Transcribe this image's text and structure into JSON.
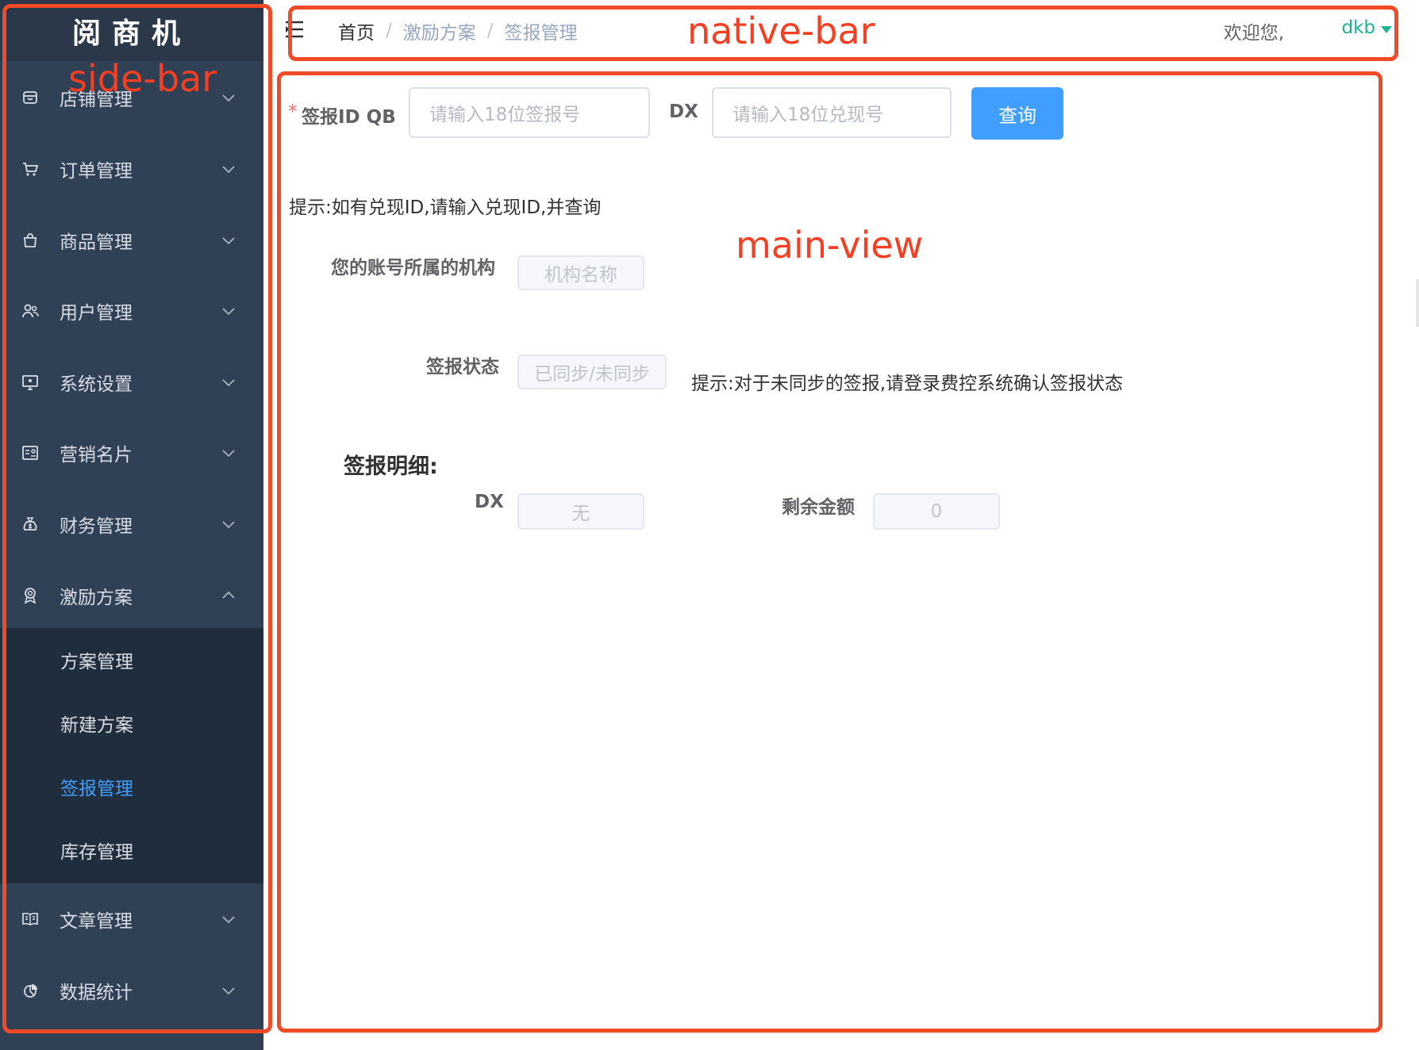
{
  "sidebar": {
    "logo": "阅商机",
    "menu_items": [
      {
        "label": "店铺管理",
        "icon": "shop-icon",
        "expanded": false
      },
      {
        "label": "订单管理",
        "icon": "cart-icon",
        "expanded": false
      },
      {
        "label": "商品管理",
        "icon": "bag-icon",
        "expanded": false
      },
      {
        "label": "用户管理",
        "icon": "users-icon",
        "expanded": false
      },
      {
        "label": "系统设置",
        "icon": "monitor-icon",
        "expanded": false
      },
      {
        "label": "营销名片",
        "icon": "card-icon",
        "expanded": false
      },
      {
        "label": "财务管理",
        "icon": "money-bag-icon",
        "expanded": false
      },
      {
        "label": "激励方案",
        "icon": "award-icon",
        "expanded": true
      },
      {
        "label": "文章管理",
        "icon": "book-icon",
        "expanded": false
      },
      {
        "label": "数据统计",
        "icon": "pie-chart-icon",
        "expanded": false
      }
    ],
    "submenu": [
      {
        "label": "方案管理",
        "active": false
      },
      {
        "label": "新建方案",
        "active": false
      },
      {
        "label": "签报管理",
        "active": true
      },
      {
        "label": "库存管理",
        "active": false
      }
    ]
  },
  "navbar": {
    "breadcrumb": [
      "首页",
      "激励方案",
      "签报管理"
    ],
    "welcome": "欢迎您,",
    "username": "dkb"
  },
  "annotations": {
    "side_bar": "side-bar",
    "native_bar": "native-bar",
    "main_view": "main-view"
  },
  "form": {
    "required_mark": "*",
    "qb_label": "签报ID QB",
    "qb_placeholder": "请输入18位签报号",
    "dx_label": "DX",
    "dx_placeholder": "请输入18位兑现号",
    "query_button": "查询",
    "hint1": "提示:如有兑现ID,请输入兑现ID,并查询",
    "org_label": "您的账号所属的机构",
    "org_value": "机构名称",
    "status_label": "签报状态",
    "status_value": "已同步/未同步",
    "hint2": "提示:对于未同步的签报,请登录费控系统确认签报状态",
    "detail_title": "签报明细:",
    "detail_dx_label": "DX",
    "detail_dx_value": "无",
    "remaining_label": "剩余金额",
    "remaining_value": "0"
  },
  "colors": {
    "sidebar_bg": "#304156",
    "submenu_bg": "#1f2d3d",
    "active": "#409eff",
    "annotation": "#f04a26",
    "username": "#1ab394"
  }
}
